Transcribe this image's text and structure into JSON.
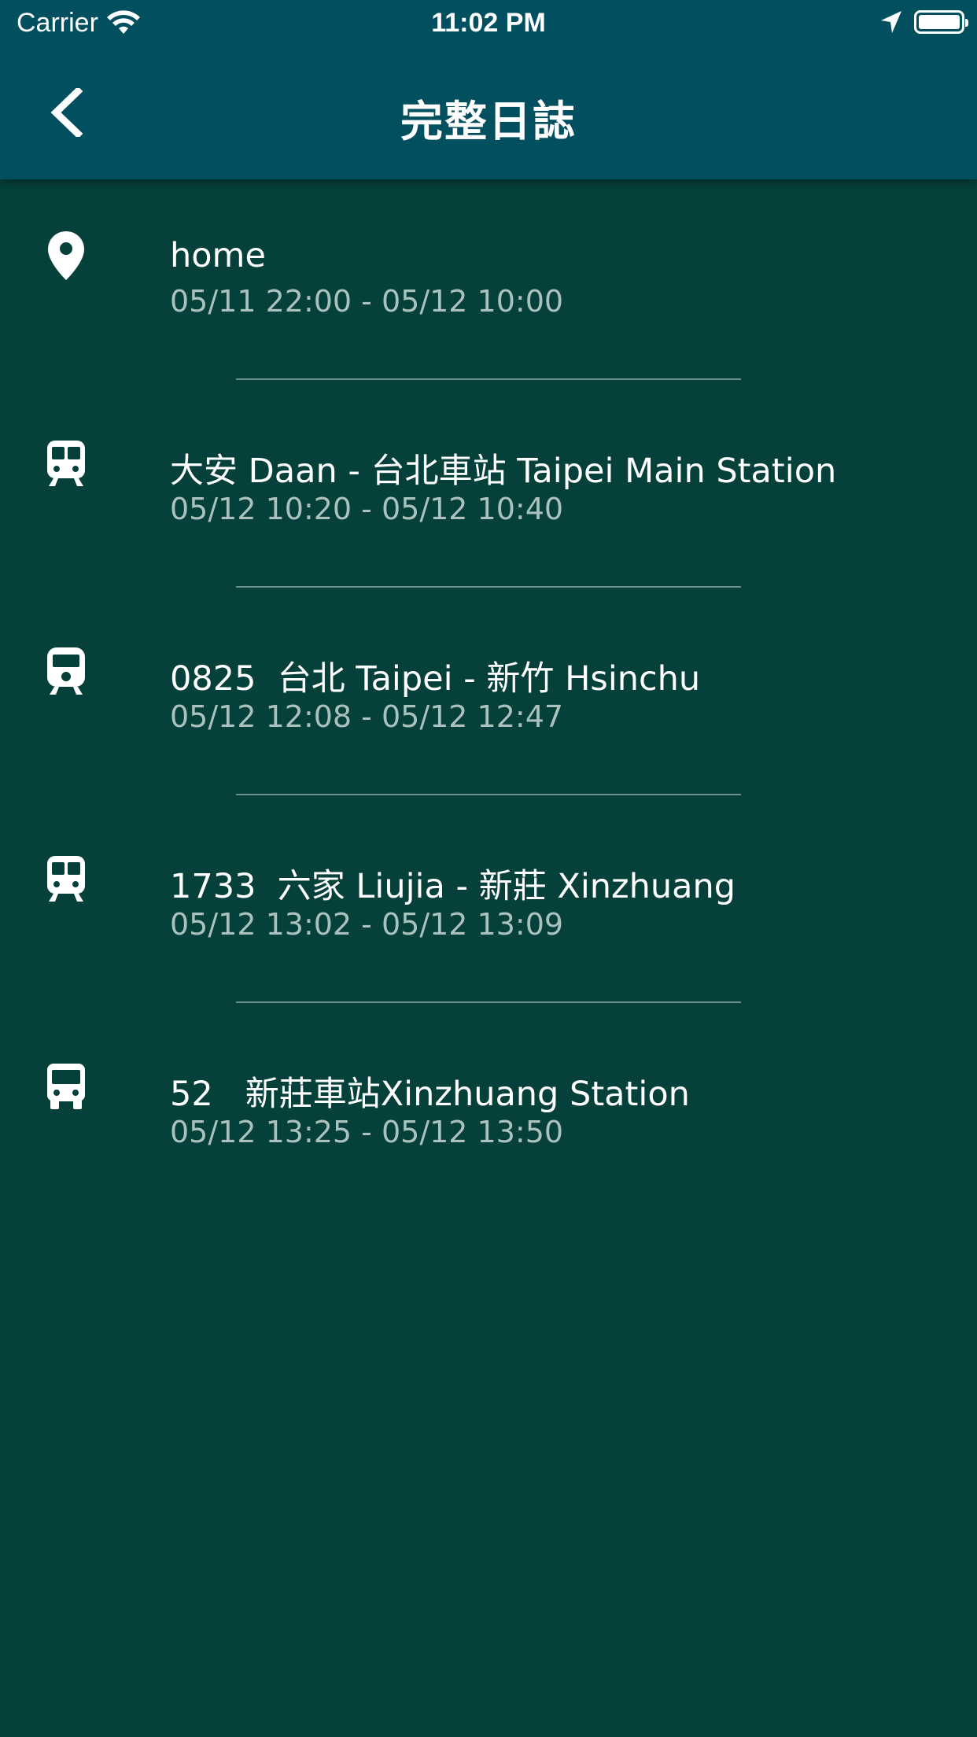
{
  "status_bar": {
    "carrier": "Carrier",
    "time": "11:02 PM"
  },
  "header": {
    "title": "完整日誌",
    "back_icon": "chevron-left-icon"
  },
  "colors": {
    "header_bg": "#02505f",
    "body_bg": "#06403b",
    "title_text": "#ffffff",
    "secondary_text": "#aac1bd"
  },
  "entries": [
    {
      "icon": "location-pin-icon",
      "title": "home",
      "time": "05/11 22:00 - 05/12 10:00"
    },
    {
      "icon": "metro-icon",
      "title": "大安 Daan - 台北車站 Taipei Main Station",
      "time": "05/12 10:20 - 05/12 10:40"
    },
    {
      "icon": "train-icon",
      "title": "0825  台北 Taipei - 新竹 Hsinchu",
      "time": "05/12 12:08 - 05/12 12:47"
    },
    {
      "icon": "metro-icon",
      "title": "1733  六家 Liujia - 新莊 Xinzhuang",
      "time": "05/12 13:02 - 05/12 13:09"
    },
    {
      "icon": "bus-icon",
      "title": "52   新莊車站Xinzhuang Station",
      "time": "05/12 13:25 - 05/12 13:50"
    }
  ]
}
